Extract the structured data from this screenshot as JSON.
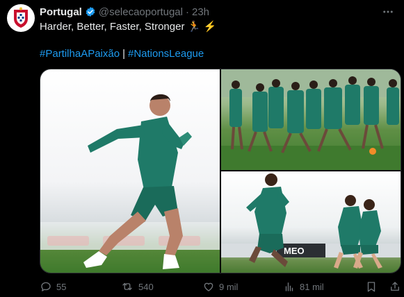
{
  "tweet": {
    "author_name": "Portugal",
    "author_handle": "@selecaoportugal",
    "separator": "·",
    "time": "23h",
    "text": "Harder, Better, Faster, Stronger 🏃 ⚡",
    "hashtags": [
      "#PartilhaAPaixão",
      "#NationsLeague"
    ],
    "hashtag_separator": "|"
  },
  "media": {
    "images": [
      {
        "icon": "player-sprinting-photo"
      },
      {
        "icon": "team-running-drill-photo"
      },
      {
        "icon": "players-training-photo"
      }
    ],
    "banner_text": "MEO"
  },
  "actions": {
    "replies": "55",
    "reposts": "540",
    "likes": "9 mil",
    "views": "81 mil"
  },
  "colors": {
    "background": "#000000",
    "text": "#e7e9ea",
    "muted": "#71767b",
    "link": "#1d9bf0",
    "verified": "#1d9bf0",
    "kit": "#1f7a68"
  }
}
